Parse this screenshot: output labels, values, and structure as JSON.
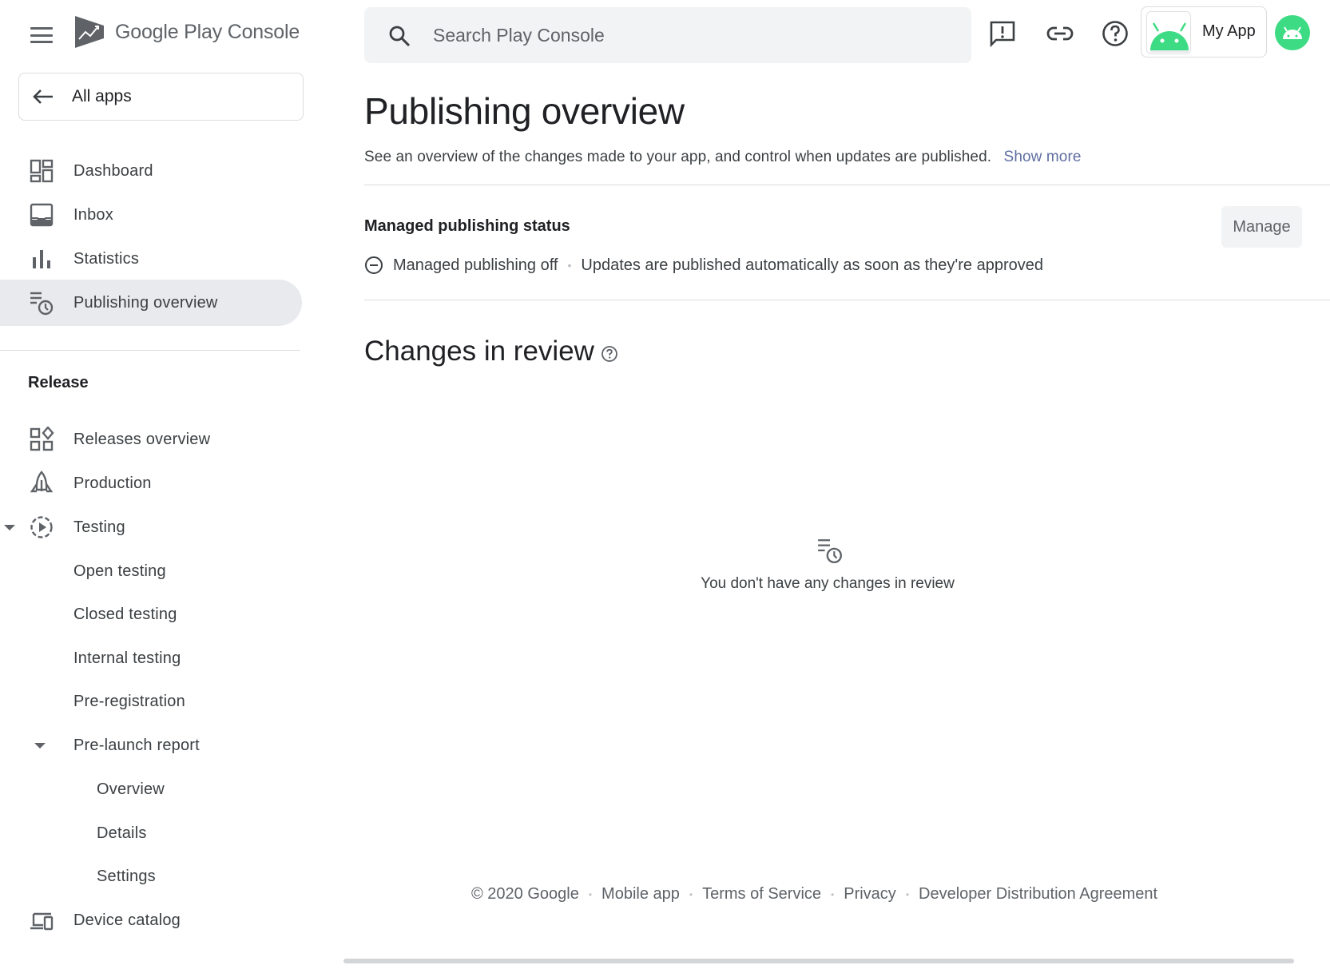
{
  "brand": {
    "name_part1": "Google Play",
    "name_part2": "Console"
  },
  "all_apps": {
    "label": "All apps"
  },
  "nav": {
    "dashboard": "Dashboard",
    "inbox": "Inbox",
    "statistics": "Statistics",
    "publishing_overview": "Publishing overview"
  },
  "release": {
    "section_label": "Release",
    "releases_overview": "Releases overview",
    "production": "Production",
    "testing": "Testing",
    "open_testing": "Open testing",
    "closed_testing": "Closed testing",
    "internal_testing": "Internal testing",
    "pre_registration": "Pre-registration",
    "pre_launch_report": "Pre-launch report",
    "overview": "Overview",
    "details": "Details",
    "settings": "Settings",
    "device_catalog": "Device catalog"
  },
  "topbar": {
    "search_placeholder": "Search Play Console",
    "app_name": "My App"
  },
  "main": {
    "title": "Publishing overview",
    "description": "See an overview of the changes made to your app, and control when updates are published.",
    "show_more": "Show more",
    "managed_status_title": "Managed publishing status",
    "manage_button": "Manage",
    "managed_state": "Managed publishing off",
    "managed_state_desc": "Updates are published automatically as soon as they're approved",
    "changes_title": "Changes in review",
    "empty_text": "You don't have any changes in review"
  },
  "footer": {
    "copyright": "© 2020 Google",
    "mobile_app": "Mobile app",
    "terms": "Terms of Service",
    "privacy": "Privacy",
    "dda": "Developer Distribution Agreement"
  },
  "colors": {
    "active_nav_bg": "#e8eaed",
    "android_green": "#3ddc84",
    "link": "#5f6ea0"
  }
}
